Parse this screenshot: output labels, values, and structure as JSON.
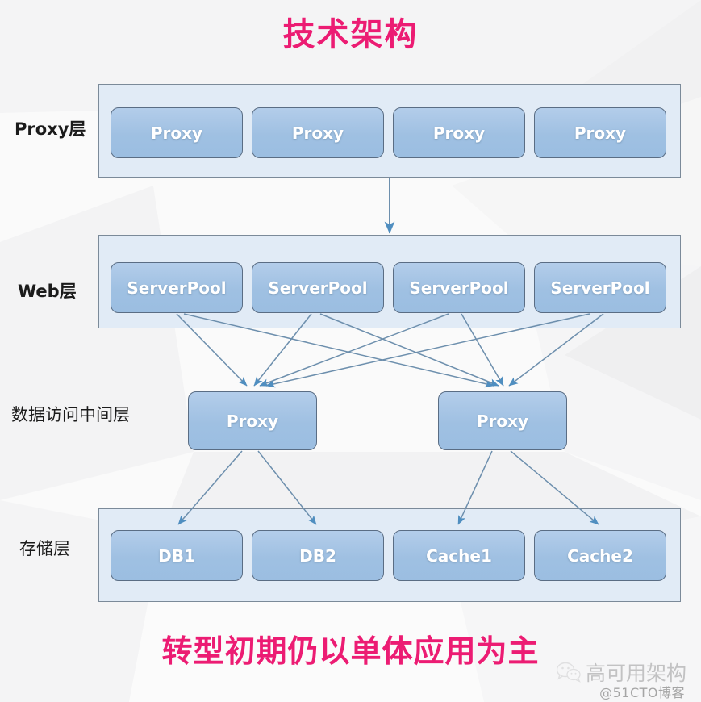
{
  "title": "技术架构",
  "caption": "转型初期仍以单体应用为主",
  "colors": {
    "title_pink": "#ec1c73",
    "node_fill": "#9fc0e2",
    "node_border": "#5a6d84",
    "layer_fill": "#e1ebf6",
    "layer_border": "#7b8a99",
    "arrow": "#5b8db8",
    "background": "#fafafa"
  },
  "layers": [
    {
      "id": "proxy-layer",
      "label": "Proxy层",
      "label_style": "bold",
      "nodes": [
        {
          "label": "Proxy"
        },
        {
          "label": "Proxy"
        },
        {
          "label": "Proxy"
        },
        {
          "label": "Proxy"
        }
      ]
    },
    {
      "id": "web-layer",
      "label": "Web层",
      "label_style": "bold",
      "nodes": [
        {
          "label": "ServerPool"
        },
        {
          "label": "ServerPool"
        },
        {
          "label": "ServerPool"
        },
        {
          "label": "ServerPool"
        }
      ]
    },
    {
      "id": "data-access-layer",
      "label": "数据访问中间层",
      "label_style": "serif",
      "nodes": [
        {
          "label": "Proxy"
        },
        {
          "label": "Proxy"
        }
      ]
    },
    {
      "id": "storage-layer",
      "label": "存储层",
      "label_style": "serif",
      "nodes": [
        {
          "label": "DB1"
        },
        {
          "label": "DB2"
        },
        {
          "label": "Cache1"
        },
        {
          "label": "Cache2"
        }
      ]
    }
  ],
  "watermark": {
    "brand": "高可用架构",
    "source": "@51CTO博客",
    "icon": "wechat-icon"
  }
}
